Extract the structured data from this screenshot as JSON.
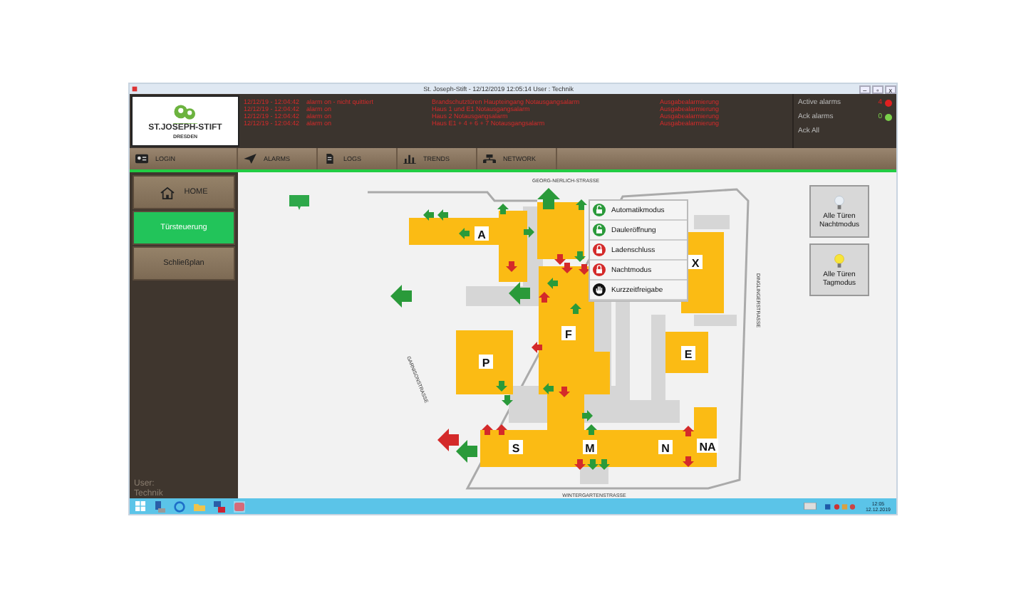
{
  "window": {
    "title": "St. Joseph-Stift - 12/12/2019 12:05:14 User : Technik",
    "controls": [
      "–",
      "▫",
      "x"
    ]
  },
  "logo": {
    "name": "ST.JOSEPH-STIFT",
    "subtitle": "DRESDEN"
  },
  "alarm_list": [
    {
      "time": "12/12/19 - 12:04:42",
      "status": "alarm on - nicht quittiert",
      "message": "Brandschutztüren Haupteingang Notausgangsalarm",
      "group": "Ausgabealarmierung"
    },
    {
      "time": "12/12/19 - 12:04:42",
      "status": "alarm on",
      "message": "Haus 1 und E1 Notausgangsalarm",
      "group": "Ausgabealarmierung"
    },
    {
      "time": "12/12/19 - 12:04:42",
      "status": "alarm on",
      "message": "Haus 2 Notausgangsalarm",
      "group": "Ausgabealarmierung"
    },
    {
      "time": "12/12/19 - 12:04:42",
      "status": "alarm on",
      "message": "Haus E1 + 4 + 6 + 7 Notausgangsalarm",
      "group": "Ausgabealarmierung"
    }
  ],
  "alarm_counters": [
    {
      "label": "Active alarms",
      "count": "4",
      "color": "#e02020"
    },
    {
      "label": "Ack alarms",
      "count": "0",
      "color": "#7ad04a"
    }
  ],
  "ack_all": "Ack All",
  "toolbar": [
    {
      "label": "LOGIN",
      "kind": "login"
    },
    {
      "label": "ALARMS",
      "kind": "alarms"
    },
    {
      "label": "LOGS",
      "kind": "logs"
    },
    {
      "label": "TRENDS",
      "kind": "trends"
    },
    {
      "label": "NETWORK",
      "kind": "network"
    }
  ],
  "sidebar": {
    "items": [
      {
        "label": "HOME",
        "kind": "home",
        "selected": false
      },
      {
        "label": "Türsteuerung",
        "kind": "plain",
        "selected": true
      },
      {
        "label": "Schließplan",
        "kind": "plain",
        "selected": false
      }
    ],
    "user_label": "User:",
    "user": "Technik"
  },
  "map": {
    "streets": [
      "GEORG-NERLICH-STRASSE",
      "WINTERGARTENSTRASSE",
      "GARNISONSTRASSE",
      "DINGLINGERSTRASSE"
    ],
    "buildings": [
      "A",
      "X",
      "F",
      "P",
      "E",
      "S",
      "M",
      "N",
      "NA"
    ],
    "gates": [
      {
        "open": true
      },
      {
        "open": true
      },
      {
        "open": true
      },
      {
        "open": false
      },
      {
        "open": true
      }
    ],
    "doors": [
      {
        "open": true
      },
      {
        "open": true
      },
      {
        "open": true
      },
      {
        "open": true
      },
      {
        "open": true
      },
      {
        "open": false
      },
      {
        "open": true
      },
      {
        "open": false
      },
      {
        "open": false
      },
      {
        "open": true
      },
      {
        "open": false
      },
      {
        "open": true
      },
      {
        "open": false
      },
      {
        "open": true
      },
      {
        "open": false
      },
      {
        "open": true
      },
      {
        "open": true
      },
      {
        "open": true
      },
      {
        "open": false
      },
      {
        "open": true
      },
      {
        "open": true
      },
      {
        "open": false
      },
      {
        "open": false
      },
      {
        "open": false
      },
      {
        "open": true
      },
      {
        "open": true
      },
      {
        "open": false
      },
      {
        "open": false
      }
    ],
    "context_menu": [
      {
        "label": "Automatikmodus",
        "kind": "unlocked"
      },
      {
        "label": "Dauleröffnung",
        "kind": "unlocked"
      },
      {
        "label": "Ladenschluss",
        "kind": "locked"
      },
      {
        "label": "Nachtmodus",
        "kind": "locked"
      },
      {
        "label": "Kurzzeitfreigabe",
        "kind": "hand"
      }
    ],
    "mode_buttons": [
      {
        "lines": [
          "Alle Türen",
          "Nachtmodus"
        ],
        "lit": false
      },
      {
        "lines": [
          "Alle Türen",
          "Tagmodus"
        ],
        "lit": true
      }
    ]
  },
  "taskbar": {
    "time": "12:05",
    "date": "12.12.2019"
  }
}
